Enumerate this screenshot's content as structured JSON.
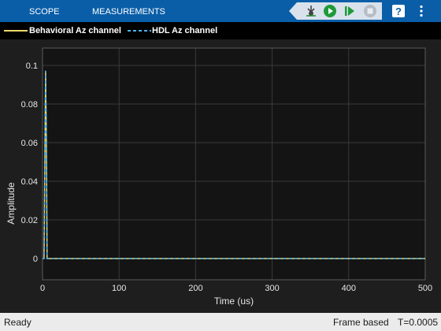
{
  "toolstrip": {
    "tabs": [
      {
        "label": "SCOPE"
      },
      {
        "label": "MEASUREMENTS"
      }
    ],
    "background": "#0a5ea8",
    "icons": [
      "pin-icon",
      "run-icon",
      "step-forward-icon",
      "stop-icon",
      "help-icon",
      "menu-icon"
    ]
  },
  "legend": {
    "entries": [
      {
        "label": "Behavioral Az channel",
        "color": "#edd96a",
        "style": "solid"
      },
      {
        "label": "HDL Az channel",
        "color": "#4db3f0",
        "style": "dashed"
      }
    ]
  },
  "axes": {
    "xlabel": "Time (us)",
    "ylabel": "Amplitude"
  },
  "chart_data": {
    "type": "line",
    "xlabel": "Time (us)",
    "ylabel": "Amplitude",
    "xlim": [
      0,
      500
    ],
    "ylim": [
      -0.011,
      0.109
    ],
    "xticks": [
      0,
      100,
      200,
      300,
      400,
      500
    ],
    "xtick_labels": [
      "0",
      "100",
      "200",
      "300",
      "400",
      "500"
    ],
    "yticks": [
      0,
      0.02,
      0.04,
      0.06,
      0.08,
      0.1
    ],
    "ytick_labels": [
      "0",
      "0.02",
      "0.04",
      "0.06",
      "0.08",
      "0.1"
    ],
    "grid": true,
    "legend_position": "top-left",
    "series": [
      {
        "name": "Behavioral Az channel",
        "color": "#edd96a",
        "style": "solid",
        "x": [
          0,
          2,
          4,
          5,
          6,
          7,
          500
        ],
        "y": [
          0,
          0,
          0.097,
          0.06,
          0,
          0,
          0
        ]
      },
      {
        "name": "HDL Az channel",
        "color": "#4db3f0",
        "style": "dashed",
        "x": [
          0,
          2,
          4,
          5,
          6,
          7,
          500
        ],
        "y": [
          0,
          0,
          0.097,
          0.06,
          0,
          0,
          0
        ]
      }
    ]
  },
  "status": {
    "ready": "Ready",
    "mode": "Frame based",
    "time": "T=0.0005"
  }
}
